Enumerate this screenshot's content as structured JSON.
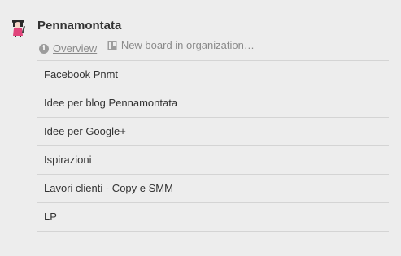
{
  "organization": {
    "name": "Pennamontata",
    "avatar_icon": "pen-mascot-icon",
    "links": [
      {
        "label": "Overview",
        "icon": "info-icon"
      },
      {
        "label": "New board in organization…",
        "icon": "board-icon"
      }
    ]
  },
  "boards": [
    {
      "label": "Facebook Pnmt"
    },
    {
      "label": "Idee per blog Pennamontata"
    },
    {
      "label": "Idee per Google+"
    },
    {
      "label": "Ispirazioni"
    },
    {
      "label": "Lavori clienti - Copy e SMM"
    },
    {
      "label": "LP"
    }
  ],
  "colors": {
    "background": "#ededed",
    "text": "#333333",
    "muted": "#8a8a8a",
    "divider": "#d4d4d4"
  }
}
